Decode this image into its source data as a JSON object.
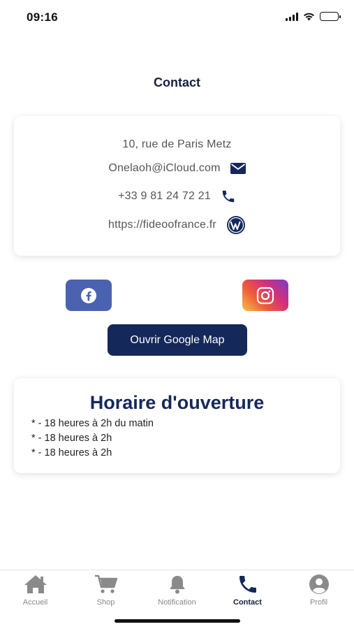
{
  "status_bar": {
    "time": "09:16"
  },
  "header": {
    "title": "Contact"
  },
  "contact": {
    "address": "10, rue de Paris Metz",
    "email": "Onelaoh@iCloud.com",
    "phone": "+33 9 81 24 72 21",
    "website": "https://fideoofrance.fr",
    "icons": {
      "email": "mail-icon",
      "phone": "phone-icon",
      "website": "wordpress-icon"
    }
  },
  "social": {
    "facebook": {
      "icon": "facebook-icon",
      "color": "#4a62b0"
    },
    "instagram": {
      "icon": "instagram-icon"
    }
  },
  "map_button": {
    "label": "Ouvrir Google Map",
    "color": "#14285a"
  },
  "hours": {
    "title": "Horaire d'ouverture",
    "items": [
      "* - 18 heures à 2h du matin",
      "* - 18 heures à 2h",
      "* - 18 heures à 2h"
    ]
  },
  "tab_bar": {
    "active": "Contact",
    "tabs": [
      {
        "label": "Accueil",
        "icon": "home-icon"
      },
      {
        "label": "Shop",
        "icon": "cart-icon"
      },
      {
        "label": "Notification",
        "icon": "bell-icon"
      },
      {
        "label": "Contact",
        "icon": "phone-icon"
      },
      {
        "label": "Profil",
        "icon": "user-icon"
      }
    ]
  },
  "colors": {
    "primary": "#14285a",
    "accent_text": "#16213e",
    "inactive_tab": "#888888"
  }
}
